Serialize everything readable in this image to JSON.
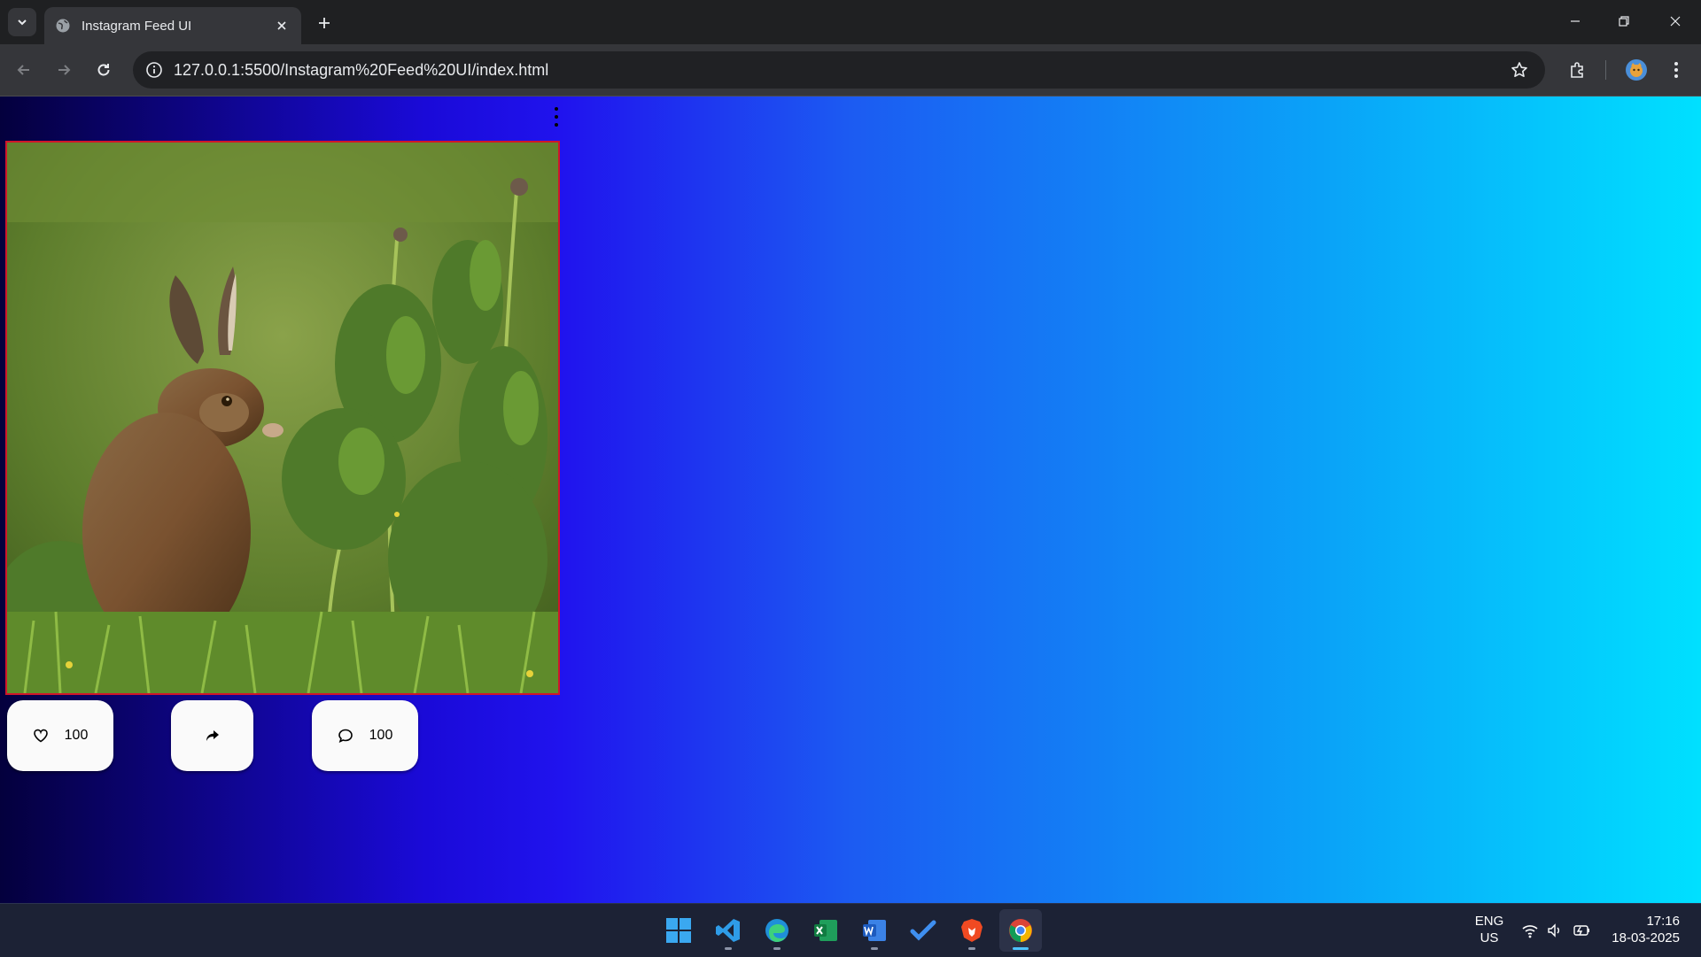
{
  "browser": {
    "tab_title": "Instagram Feed UI",
    "url": "127.0.0.1:5500/Instagram%20Feed%20UI/index.html"
  },
  "post": {
    "image_subject": "brown hare sitting in green grass beside thistles",
    "like_count": "100",
    "comment_count": "100"
  },
  "colors": {
    "gradient": [
      "#04003d",
      "#2013ee",
      "#1c5bf2",
      "#00e0ff"
    ],
    "post_border": "#d0162a",
    "button_bg": "#fafafa"
  },
  "taskbar": {
    "apps": [
      "start-icon",
      "vscode-icon",
      "edge-icon",
      "excel-icon",
      "word-icon",
      "todo-icon",
      "brave-icon",
      "chrome-icon"
    ],
    "language_line1": "ENG",
    "language_line2": "US",
    "time": "17:16",
    "date": "18-03-2025"
  }
}
